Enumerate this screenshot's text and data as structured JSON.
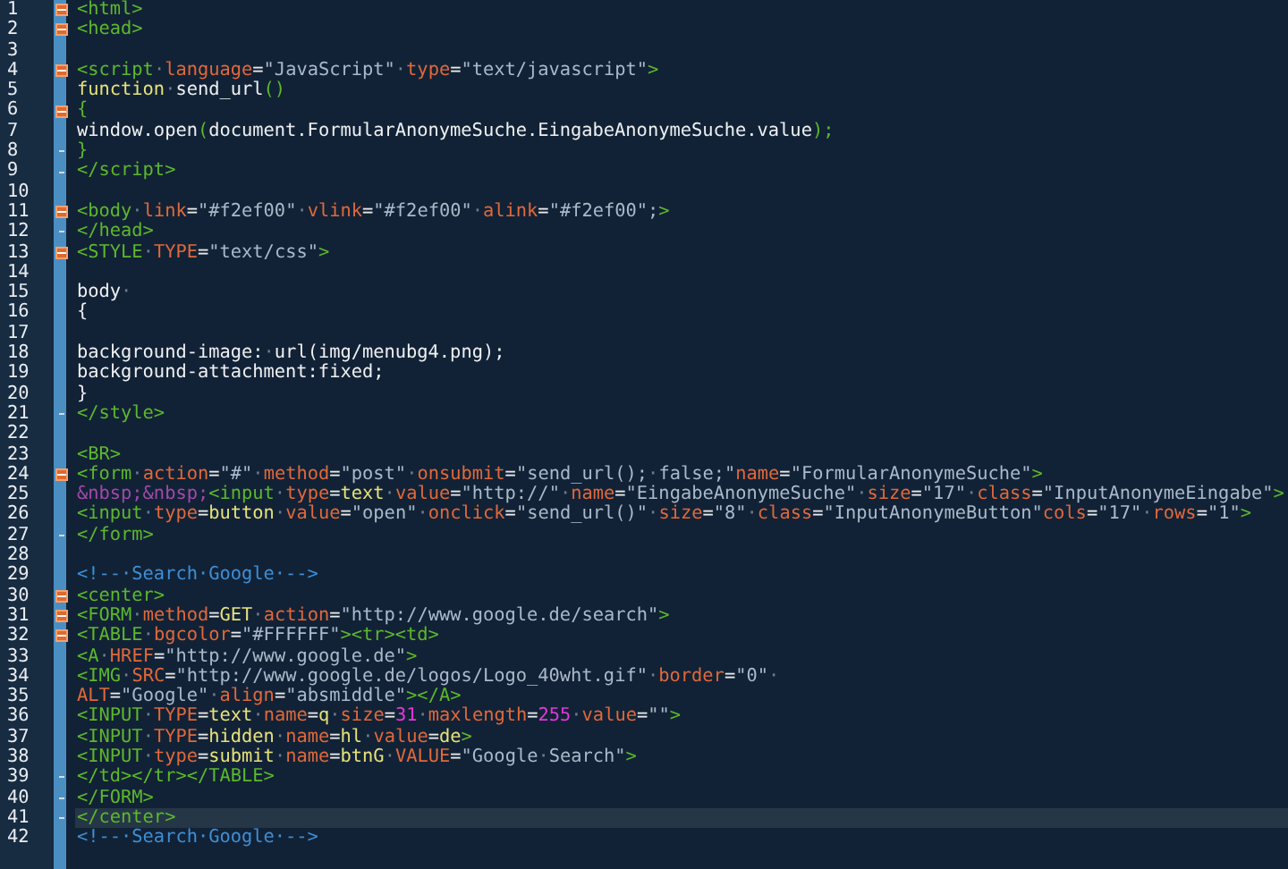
{
  "editor": {
    "lines": [
      {
        "number": "1",
        "fold_start": true,
        "fold_end": false,
        "current": false,
        "tokens": [
          {
            "kind": "tag",
            "text": "<html>"
          }
        ]
      },
      {
        "number": "2",
        "fold_start": true,
        "fold_end": false,
        "current": false,
        "tokens": [
          {
            "kind": "tag",
            "text": "<head>"
          }
        ]
      },
      {
        "number": "3",
        "fold_start": false,
        "fold_end": false,
        "current": false
      },
      {
        "number": "4",
        "fold_start": true,
        "fold_end": false,
        "current": false,
        "tokens": [
          {
            "kind": "tag",
            "text": "<script"
          },
          {
            "kind": "ws",
            "text": "·"
          },
          {
            "kind": "attr",
            "text": "language"
          },
          {
            "kind": "eq",
            "text": "="
          },
          {
            "kind": "str",
            "text": "\"JavaScript\""
          },
          {
            "kind": "ws",
            "text": "·"
          },
          {
            "kind": "attr",
            "text": "type"
          },
          {
            "kind": "eq",
            "text": "="
          },
          {
            "kind": "str",
            "text": "\"text/javascript\""
          },
          {
            "kind": "tag",
            "text": ">"
          }
        ]
      },
      {
        "number": "5",
        "fold_start": false,
        "fold_end": false,
        "current": false,
        "tokens": [
          {
            "kind": "val",
            "text": "function"
          },
          {
            "kind": "ws",
            "text": "·"
          },
          {
            "kind": "plain",
            "text": "send_url"
          },
          {
            "kind": "tag",
            "text": "()"
          }
        ]
      },
      {
        "number": "6",
        "fold_start": true,
        "fold_end": false,
        "current": false,
        "tokens": [
          {
            "kind": "tag",
            "text": "{"
          }
        ]
      },
      {
        "number": "7",
        "fold_start": false,
        "fold_end": false,
        "current": false,
        "tokens": [
          {
            "kind": "plain",
            "text": "window.open"
          },
          {
            "kind": "tag",
            "text": "("
          },
          {
            "kind": "plain",
            "text": "document.FormularAnonymeSuche.EingabeAnonymeSuche.value"
          },
          {
            "kind": "tag",
            "text": ");"
          }
        ]
      },
      {
        "number": "8",
        "fold_start": false,
        "fold_end": true,
        "current": false,
        "tokens": [
          {
            "kind": "tag",
            "text": "}"
          }
        ]
      },
      {
        "number": "9",
        "fold_start": false,
        "fold_end": true,
        "current": false,
        "tokens": [
          {
            "kind": "tag",
            "text": "</script>"
          }
        ]
      },
      {
        "number": "10",
        "fold_start": false,
        "fold_end": false,
        "current": false
      },
      {
        "number": "11",
        "fold_start": true,
        "fold_end": false,
        "current": false,
        "tokens": [
          {
            "kind": "tag",
            "text": "<body"
          },
          {
            "kind": "ws",
            "text": "·"
          },
          {
            "kind": "attr",
            "text": "link"
          },
          {
            "kind": "eq",
            "text": "="
          },
          {
            "kind": "str",
            "text": "\"#f2ef00\""
          },
          {
            "kind": "ws",
            "text": "·"
          },
          {
            "kind": "attr",
            "text": "vlink"
          },
          {
            "kind": "eq",
            "text": "="
          },
          {
            "kind": "str",
            "text": "\"#f2ef00\""
          },
          {
            "kind": "ws",
            "text": "·"
          },
          {
            "kind": "attr",
            "text": "alink"
          },
          {
            "kind": "eq",
            "text": "="
          },
          {
            "kind": "str",
            "text": "\"#f2ef00\";"
          },
          {
            "kind": "tag",
            "text": ">"
          }
        ]
      },
      {
        "number": "12",
        "fold_start": false,
        "fold_end": true,
        "current": false,
        "tokens": [
          {
            "kind": "tag",
            "text": "</head>"
          }
        ]
      },
      {
        "number": "13",
        "fold_start": true,
        "fold_end": false,
        "current": false,
        "tokens": [
          {
            "kind": "tag",
            "text": "<STYLE"
          },
          {
            "kind": "ws",
            "text": "·"
          },
          {
            "kind": "attr",
            "text": "TYPE"
          },
          {
            "kind": "eq",
            "text": "="
          },
          {
            "kind": "str",
            "text": "\"text/css\""
          },
          {
            "kind": "tag",
            "text": ">"
          }
        ]
      },
      {
        "number": "14",
        "fold_start": false,
        "fold_end": false,
        "current": false
      },
      {
        "number": "15",
        "fold_start": false,
        "fold_end": false,
        "current": false,
        "tokens": [
          {
            "kind": "plain",
            "text": "body"
          },
          {
            "kind": "ws",
            "text": "·"
          }
        ]
      },
      {
        "number": "16",
        "fold_start": false,
        "fold_end": false,
        "current": false,
        "tokens": [
          {
            "kind": "plain",
            "text": "{"
          }
        ]
      },
      {
        "number": "17",
        "fold_start": false,
        "fold_end": false,
        "current": false
      },
      {
        "number": "18",
        "fold_start": false,
        "fold_end": false,
        "current": false,
        "tokens": [
          {
            "kind": "plain",
            "text": "background-image:"
          },
          {
            "kind": "ws",
            "text": "·"
          },
          {
            "kind": "plain",
            "text": "url(img/menubg4.png);"
          }
        ]
      },
      {
        "number": "19",
        "fold_start": false,
        "fold_end": false,
        "current": false,
        "tokens": [
          {
            "kind": "plain",
            "text": "background-attachment:fixed;"
          }
        ]
      },
      {
        "number": "20",
        "fold_start": false,
        "fold_end": false,
        "current": false,
        "tokens": [
          {
            "kind": "plain",
            "text": "}"
          }
        ]
      },
      {
        "number": "21",
        "fold_start": false,
        "fold_end": true,
        "current": false,
        "tokens": [
          {
            "kind": "tag",
            "text": "</style>"
          }
        ]
      },
      {
        "number": "22",
        "fold_start": false,
        "fold_end": false,
        "current": false
      },
      {
        "number": "23",
        "fold_start": false,
        "fold_end": false,
        "current": false,
        "tokens": [
          {
            "kind": "tag",
            "text": "<BR>"
          }
        ]
      },
      {
        "number": "24",
        "fold_start": true,
        "fold_end": false,
        "current": false,
        "tokens": [
          {
            "kind": "tag",
            "text": "<form"
          },
          {
            "kind": "ws",
            "text": "·"
          },
          {
            "kind": "attr",
            "text": "action"
          },
          {
            "kind": "eq",
            "text": "="
          },
          {
            "kind": "str",
            "text": "\"#\""
          },
          {
            "kind": "ws",
            "text": "·"
          },
          {
            "kind": "attr",
            "text": "method"
          },
          {
            "kind": "eq",
            "text": "="
          },
          {
            "kind": "str",
            "text": "\"post\""
          },
          {
            "kind": "ws",
            "text": "·"
          },
          {
            "kind": "attr",
            "text": "onsubmit"
          },
          {
            "kind": "eq",
            "text": "="
          },
          {
            "kind": "str",
            "text": "\"send_url();"
          },
          {
            "kind": "ws",
            "text": "·"
          },
          {
            "kind": "str",
            "text": "false;\""
          },
          {
            "kind": "attr",
            "text": "name"
          },
          {
            "kind": "eq",
            "text": "="
          },
          {
            "kind": "str",
            "text": "\"FormularAnonymeSuche\""
          },
          {
            "kind": "tag",
            "text": ">"
          }
        ]
      },
      {
        "number": "25",
        "fold_start": false,
        "fold_end": false,
        "current": false,
        "tokens": [
          {
            "kind": "entity",
            "text": "&nbsp;&nbsp;"
          },
          {
            "kind": "tag",
            "text": "<input"
          },
          {
            "kind": "ws",
            "text": "·"
          },
          {
            "kind": "attr",
            "text": "type"
          },
          {
            "kind": "eq",
            "text": "="
          },
          {
            "kind": "val",
            "text": "text"
          },
          {
            "kind": "ws",
            "text": "·"
          },
          {
            "kind": "attr",
            "text": "value"
          },
          {
            "kind": "eq",
            "text": "="
          },
          {
            "kind": "str",
            "text": "\"http://\""
          },
          {
            "kind": "ws",
            "text": "·"
          },
          {
            "kind": "attr",
            "text": "name"
          },
          {
            "kind": "eq",
            "text": "="
          },
          {
            "kind": "str",
            "text": "\"EingabeAnonymeSuche\""
          },
          {
            "kind": "ws",
            "text": "·"
          },
          {
            "kind": "attr",
            "text": "size"
          },
          {
            "kind": "eq",
            "text": "="
          },
          {
            "kind": "str",
            "text": "\"17\""
          },
          {
            "kind": "ws",
            "text": "·"
          },
          {
            "kind": "attr",
            "text": "class"
          },
          {
            "kind": "eq",
            "text": "="
          },
          {
            "kind": "str",
            "text": "\"InputAnonymeEingabe\""
          },
          {
            "kind": "tag",
            "text": ">"
          }
        ]
      },
      {
        "number": "26",
        "fold_start": false,
        "fold_end": false,
        "current": false,
        "tokens": [
          {
            "kind": "tag",
            "text": "<input"
          },
          {
            "kind": "ws",
            "text": "·"
          },
          {
            "kind": "attr",
            "text": "type"
          },
          {
            "kind": "eq",
            "text": "="
          },
          {
            "kind": "val",
            "text": "button"
          },
          {
            "kind": "ws",
            "text": "·"
          },
          {
            "kind": "attr",
            "text": "value"
          },
          {
            "kind": "eq",
            "text": "="
          },
          {
            "kind": "str",
            "text": "\"open\""
          },
          {
            "kind": "ws",
            "text": "·"
          },
          {
            "kind": "attr",
            "text": "onclick"
          },
          {
            "kind": "eq",
            "text": "="
          },
          {
            "kind": "str",
            "text": "\"send_url()\""
          },
          {
            "kind": "ws",
            "text": "·"
          },
          {
            "kind": "attr",
            "text": "size"
          },
          {
            "kind": "eq",
            "text": "="
          },
          {
            "kind": "str",
            "text": "\"8\""
          },
          {
            "kind": "ws",
            "text": "·"
          },
          {
            "kind": "attr",
            "text": "class"
          },
          {
            "kind": "eq",
            "text": "="
          },
          {
            "kind": "str",
            "text": "\"InputAnonymeButton\""
          },
          {
            "kind": "attr",
            "text": "cols"
          },
          {
            "kind": "eq",
            "text": "="
          },
          {
            "kind": "str",
            "text": "\"17\""
          },
          {
            "kind": "ws",
            "text": "·"
          },
          {
            "kind": "attr",
            "text": "rows"
          },
          {
            "kind": "eq",
            "text": "="
          },
          {
            "kind": "str",
            "text": "\"1\""
          },
          {
            "kind": "tag",
            "text": ">"
          }
        ]
      },
      {
        "number": "27",
        "fold_start": false,
        "fold_end": true,
        "current": false,
        "tokens": [
          {
            "kind": "tag",
            "text": "</form>"
          }
        ]
      },
      {
        "number": "28",
        "fold_start": false,
        "fold_end": false,
        "current": false
      },
      {
        "number": "29",
        "fold_start": false,
        "fold_end": false,
        "current": false,
        "tokens": [
          {
            "kind": "comment",
            "text": "<!--·Search·Google·-->"
          }
        ]
      },
      {
        "number": "30",
        "fold_start": true,
        "fold_end": false,
        "current": false,
        "tokens": [
          {
            "kind": "tag",
            "text": "<center>"
          }
        ]
      },
      {
        "number": "31",
        "fold_start": true,
        "fold_end": false,
        "current": false,
        "tokens": [
          {
            "kind": "tag",
            "text": "<FORM"
          },
          {
            "kind": "ws",
            "text": "·"
          },
          {
            "kind": "attr",
            "text": "method"
          },
          {
            "kind": "eq",
            "text": "="
          },
          {
            "kind": "val",
            "text": "GET"
          },
          {
            "kind": "ws",
            "text": "·"
          },
          {
            "kind": "attr",
            "text": "action"
          },
          {
            "kind": "eq",
            "text": "="
          },
          {
            "kind": "str",
            "text": "\"http://www.google.de/search\""
          },
          {
            "kind": "tag",
            "text": ">"
          }
        ]
      },
      {
        "number": "32",
        "fold_start": true,
        "fold_end": false,
        "current": false,
        "tokens": [
          {
            "kind": "tag",
            "text": "<TABLE"
          },
          {
            "kind": "ws",
            "text": "·"
          },
          {
            "kind": "attr",
            "text": "bgcolor"
          },
          {
            "kind": "eq",
            "text": "="
          },
          {
            "kind": "str",
            "text": "\"#FFFFFF\""
          },
          {
            "kind": "tag",
            "text": "><tr><td>"
          }
        ]
      },
      {
        "number": "33",
        "fold_start": false,
        "fold_end": false,
        "current": false,
        "tokens": [
          {
            "kind": "tag",
            "text": "<A"
          },
          {
            "kind": "ws",
            "text": "·"
          },
          {
            "kind": "attr",
            "text": "HREF"
          },
          {
            "kind": "eq",
            "text": "="
          },
          {
            "kind": "str",
            "text": "\"http://www.google.de\""
          },
          {
            "kind": "tag",
            "text": ">"
          }
        ]
      },
      {
        "number": "34",
        "fold_start": false,
        "fold_end": false,
        "current": false,
        "tokens": [
          {
            "kind": "tag",
            "text": "<IMG"
          },
          {
            "kind": "ws",
            "text": "·"
          },
          {
            "kind": "attr",
            "text": "SRC"
          },
          {
            "kind": "eq",
            "text": "="
          },
          {
            "kind": "str",
            "text": "\"http://www.google.de/logos/Logo_40wht.gif\""
          },
          {
            "kind": "ws",
            "text": "·"
          },
          {
            "kind": "attr",
            "text": "border"
          },
          {
            "kind": "eq",
            "text": "="
          },
          {
            "kind": "str",
            "text": "\"0\""
          },
          {
            "kind": "ws",
            "text": "·"
          }
        ]
      },
      {
        "number": "35",
        "fold_start": false,
        "fold_end": false,
        "current": false,
        "tokens": [
          {
            "kind": "attr",
            "text": "ALT"
          },
          {
            "kind": "eq",
            "text": "="
          },
          {
            "kind": "str",
            "text": "\"Google\""
          },
          {
            "kind": "ws",
            "text": "·"
          },
          {
            "kind": "attr",
            "text": "align"
          },
          {
            "kind": "eq",
            "text": "="
          },
          {
            "kind": "str",
            "text": "\"absmiddle\""
          },
          {
            "kind": "tag",
            "text": "></A>"
          }
        ]
      },
      {
        "number": "36",
        "fold_start": false,
        "fold_end": false,
        "current": false,
        "tokens": [
          {
            "kind": "tag",
            "text": "<INPUT"
          },
          {
            "kind": "ws",
            "text": "·"
          },
          {
            "kind": "attr",
            "text": "TYPE"
          },
          {
            "kind": "eq",
            "text": "="
          },
          {
            "kind": "val",
            "text": "text"
          },
          {
            "kind": "ws",
            "text": "·"
          },
          {
            "kind": "attr",
            "text": "name"
          },
          {
            "kind": "eq",
            "text": "="
          },
          {
            "kind": "val",
            "text": "q"
          },
          {
            "kind": "ws",
            "text": "·"
          },
          {
            "kind": "attr",
            "text": "size"
          },
          {
            "kind": "eq",
            "text": "="
          },
          {
            "kind": "num",
            "text": "31"
          },
          {
            "kind": "ws",
            "text": "·"
          },
          {
            "kind": "attr",
            "text": "maxlength"
          },
          {
            "kind": "eq",
            "text": "="
          },
          {
            "kind": "num",
            "text": "255"
          },
          {
            "kind": "ws",
            "text": "·"
          },
          {
            "kind": "attr",
            "text": "value"
          },
          {
            "kind": "eq",
            "text": "="
          },
          {
            "kind": "str",
            "text": "\"\""
          },
          {
            "kind": "tag",
            "text": ">"
          }
        ]
      },
      {
        "number": "37",
        "fold_start": false,
        "fold_end": false,
        "current": false,
        "tokens": [
          {
            "kind": "tag",
            "text": "<INPUT"
          },
          {
            "kind": "ws",
            "text": "·"
          },
          {
            "kind": "attr",
            "text": "TYPE"
          },
          {
            "kind": "eq",
            "text": "="
          },
          {
            "kind": "val",
            "text": "hidden"
          },
          {
            "kind": "ws",
            "text": "·"
          },
          {
            "kind": "attr",
            "text": "name"
          },
          {
            "kind": "eq",
            "text": "="
          },
          {
            "kind": "val",
            "text": "hl"
          },
          {
            "kind": "ws",
            "text": "·"
          },
          {
            "kind": "attr",
            "text": "value"
          },
          {
            "kind": "eq",
            "text": "="
          },
          {
            "kind": "val",
            "text": "de"
          },
          {
            "kind": "tag",
            "text": ">"
          }
        ]
      },
      {
        "number": "38",
        "fold_start": false,
        "fold_end": false,
        "current": false,
        "tokens": [
          {
            "kind": "tag",
            "text": "<INPUT"
          },
          {
            "kind": "ws",
            "text": "·"
          },
          {
            "kind": "attr",
            "text": "type"
          },
          {
            "kind": "eq",
            "text": "="
          },
          {
            "kind": "val",
            "text": "submit"
          },
          {
            "kind": "ws",
            "text": "·"
          },
          {
            "kind": "attr",
            "text": "name"
          },
          {
            "kind": "eq",
            "text": "="
          },
          {
            "kind": "val",
            "text": "btnG"
          },
          {
            "kind": "ws",
            "text": "·"
          },
          {
            "kind": "attr",
            "text": "VALUE"
          },
          {
            "kind": "eq",
            "text": "="
          },
          {
            "kind": "str",
            "text": "\"Google"
          },
          {
            "kind": "ws",
            "text": "·"
          },
          {
            "kind": "str",
            "text": "Search\""
          },
          {
            "kind": "tag",
            "text": ">"
          }
        ]
      },
      {
        "number": "39",
        "fold_start": false,
        "fold_end": true,
        "current": false,
        "tokens": [
          {
            "kind": "tag",
            "text": "</td></tr></TABLE>"
          }
        ]
      },
      {
        "number": "40",
        "fold_start": false,
        "fold_end": true,
        "current": false,
        "tokens": [
          {
            "kind": "tag",
            "text": "</FORM>"
          }
        ]
      },
      {
        "number": "41",
        "fold_start": false,
        "fold_end": true,
        "current": true,
        "tokens": [
          {
            "kind": "tag",
            "text": "</center>"
          }
        ]
      },
      {
        "number": "42",
        "fold_start": false,
        "fold_end": false,
        "current": false,
        "tokens": [
          {
            "kind": "comment",
            "text": "<!--·Search·Google·-->"
          }
        ]
      }
    ]
  }
}
